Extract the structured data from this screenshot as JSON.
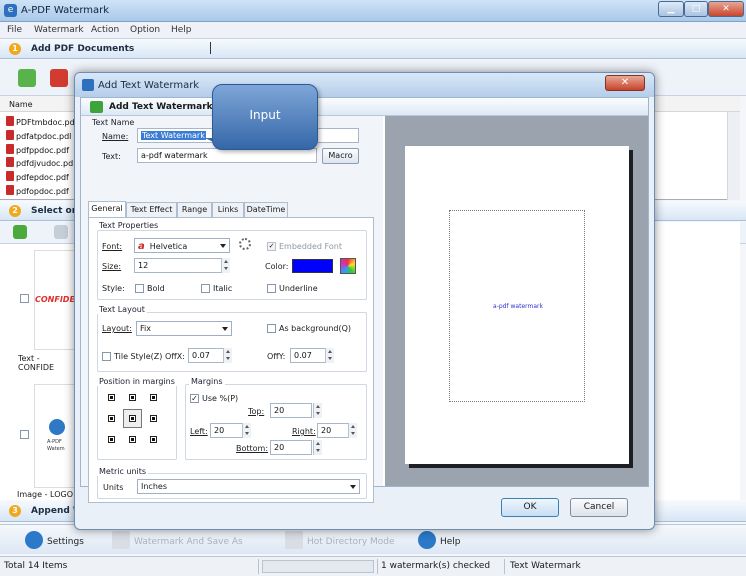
{
  "app": {
    "title": "A-PDF Watermark",
    "icon_letter": "e",
    "window_buttons": {
      "minimize": "▁",
      "maximize": "□",
      "close": "✕"
    }
  },
  "menu": [
    "File",
    "Watermark",
    "Action",
    "Option",
    "Help"
  ],
  "sections": {
    "add_pdf": {
      "num": "1",
      "label": "Add PDF Documents"
    },
    "select_watermark": {
      "num": "2",
      "label": "Select one"
    },
    "append": {
      "num": "3",
      "label": "Append W"
    }
  },
  "filelist": {
    "column": "Name",
    "files": [
      "PDFtmbdoc.pd",
      "pdfatpdoc.pdl",
      "pdfppdoc.pdf",
      "pdfdjvudoc.pd",
      "pdfepdoc.pdf",
      "pdfopdoc.pdf"
    ]
  },
  "thumbnails": [
    {
      "label": "Text - CONFIDE",
      "preview_text": "CONFIDE"
    },
    {
      "label": "Image - LOGO",
      "preview_text": "A-PDF Watem"
    }
  ],
  "bottombar": {
    "settings": "Settings",
    "watermark_save": "Watermark And Save As",
    "hot_directory": "Hot Directory Mode",
    "help": "Help"
  },
  "status": {
    "total": "Total 14 Items",
    "checked": "1 watermark(s) checked",
    "type": "Text Watermark"
  },
  "dialog": {
    "title": "Add Text Watermark",
    "header": "Add Text Watermark",
    "close": "✕",
    "callout": "Input",
    "text_name_group": "Text Name",
    "name_label": "Name:",
    "name_value": "Text Watermark",
    "text_label": "Text:",
    "text_value": "a-pdf watermark",
    "macro": "Macro",
    "tabs": [
      "General",
      "Text Effect",
      "Range",
      "Links",
      "DateTime"
    ],
    "text_properties": "Text Properties",
    "font_label": "Font:",
    "font_value": "Helvetica",
    "font_glyph": "a",
    "embedded_font": "Embedded Font",
    "size_label": "Size:",
    "size_value": "12",
    "color_label": "Color:",
    "color_value": "#0000ff",
    "style_label": "Style:",
    "bold": "Bold",
    "italic": "Italic",
    "underline": "Underline",
    "text_layout": "Text Layout",
    "layout_label": "Layout:",
    "layout_value": "Fix",
    "as_background": "As background(Q)",
    "tile_style": "Tile Style(Z)",
    "offx_label": "OffX:",
    "offx_value": "0.07",
    "offy_label": "OffY:",
    "offy_value": "0.07",
    "position_group": "Position in margins",
    "margins_group": "Margins",
    "use_percent": "Use %(P)",
    "use_percent_checked": "✓",
    "top_label": "Top:",
    "top_value": "20",
    "left_label": "Left:",
    "left_value": "20",
    "right_label": "Right:",
    "right_value": "20",
    "bottom_label": "Bottom:",
    "bottom_value": "20",
    "metric_group": "Metric units",
    "units_label": "Units",
    "units_value": "Inches",
    "preview_text": "a-pdf watermark",
    "ok": "OK",
    "cancel": "Cancel"
  },
  "colors": {
    "accent": "#3567a8",
    "watermark_color": "#0000ff",
    "section_badge": "#f0a81c"
  }
}
